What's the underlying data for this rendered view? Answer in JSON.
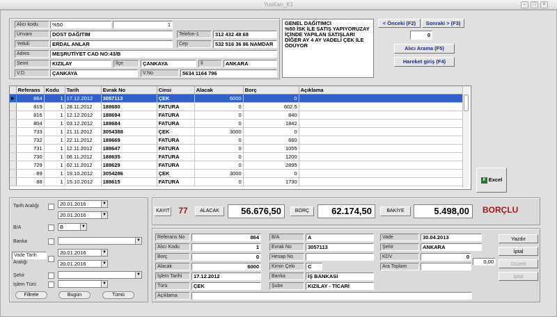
{
  "window": {
    "title": "YusKarı_K1"
  },
  "header": {
    "alici_kodu_label": "Alıcı kodu",
    "alici_kodu": "%50",
    "alici_no": "1",
    "unvan_label": "Ünvanı",
    "unvan": "DOST DAĞITIM",
    "tel_label": "Telefon-1",
    "tel": "312 432 48 68",
    "yetkili_label": "Yetkili",
    "yetkili": "ERDAL ANLAR",
    "cep_label": "Cep",
    "cep": "532 516 36 86 NAMDAR",
    "adres_label": "Adres",
    "adres": "MEŞRUTİYET CAD NO:43/B",
    "semt_label": "Semt",
    "semt": "KIZILAY",
    "ilce_label": "İlçe",
    "ilce": "ÇANKAYA",
    "il_label": "İl",
    "il": "ANKARA",
    "vd_label": "V.D.",
    "vd": "ÇANKAYA",
    "vno_label": "V.No",
    "vno": "5634 1164 796",
    "note": "GENEL DAĞITIMCI\n%50 İSK İLE SATIŞ YAPIYORUZAY İÇİNDE YAPILAN SATIŞLARI DİĞER AY 4 AY VADELİ ÇEK İLE ÖDÜYOR",
    "prev_btn": "< Önceki (F2)",
    "next_btn": "Sonraki > (F3)",
    "counter": "0",
    "search_btn": "Alıcı Arama (F5)",
    "move_btn": "Hareket giriş (F4)"
  },
  "grid": {
    "columns": [
      "Referans",
      "Kodu",
      "Tarih",
      "Evrak No",
      "Cinsi",
      "Alacak",
      "Borç",
      "Açıklama"
    ],
    "rows": [
      [
        "864",
        "1",
        "17.12.2012",
        "3057113",
        "ÇEK",
        "6000",
        "0",
        ""
      ],
      [
        "819",
        "1",
        "28.11.2012",
        "188680",
        "FATURA",
        "0",
        "602.5",
        ""
      ],
      [
        "816",
        "1",
        "12.12.2012",
        "188694",
        "FATURA",
        "0",
        "840",
        ""
      ],
      [
        "804",
        "1",
        "03.12.2012",
        "188684",
        "FATURA",
        "0",
        "1842",
        ""
      ],
      [
        "733",
        "1",
        "21.11.2012",
        "3054388",
        "ÇEK",
        "3000",
        "0",
        ""
      ],
      [
        "732",
        "1",
        "22.11.2012",
        "188669",
        "FATURA",
        "0",
        "660",
        ""
      ],
      [
        "731",
        "1",
        "12.11.2012",
        "188647",
        "FATURA",
        "0",
        "1055",
        ""
      ],
      [
        "730",
        "1",
        "06.11.2012",
        "188635",
        "FATURA",
        "0",
        "1200",
        ""
      ],
      [
        "729",
        "1",
        "02.11.2012",
        "188629",
        "FATURA",
        "0",
        "2895",
        ""
      ],
      [
        "89",
        "1",
        "19.10.2012",
        "3054286",
        "ÇEK",
        "3000",
        "0",
        ""
      ],
      [
        "88",
        "1",
        "15.10.2012",
        "188615",
        "FATURA",
        "0",
        "1730",
        ""
      ]
    ]
  },
  "excel_btn": "Excel",
  "filter": {
    "tarih_label": "Tarih Aralığı",
    "date1": "20.01.2016",
    "date2": "20.01.2016",
    "ba_label": "B/A",
    "ba": "B",
    "banka_label": "Banka",
    "vade_label": "Vade Tarih",
    "aralik_label": "Aralığı",
    "vdate1": "20.01.2016",
    "vdate2": "20.01.2016",
    "sehir_label": "Şehir",
    "islem_label": "İşlem Türü",
    "filtrele": "Filtrele",
    "bugun": "Bugün",
    "tumu": "Tümü"
  },
  "summary": {
    "kayit_label": "KAYIT",
    "kayit": "77",
    "alacak_label": "ALACAK",
    "alacak": "56.676,50",
    "borc_label": "BORÇ",
    "borc": "62.174,50",
    "bakiye_label": "BAKİYE",
    "bakiye": "5.498,00",
    "status": "BORÇLU",
    "status_color": "#a01818"
  },
  "detail": {
    "ref_label": "Referans No",
    "ref": "864",
    "ak_label": "Alıcı Kodu",
    "ak": "1",
    "borc_label": "Borç",
    "borc": "0",
    "alacak_label": "Alacak",
    "alacak": "6000",
    "it_label": "İşlem Tarihi",
    "it": "17.12.2012",
    "turu_label": "Türü",
    "turu": "ÇEK",
    "acik_label": "Açıklama",
    "acik": "",
    "ba_label": "B/A",
    "ba": "A",
    "evrak_label": "Evrak No",
    "evrak": "3057113",
    "hesap_label": "Hesap No",
    "hesap": "",
    "kimin_label": "Kimin Çeki",
    "kimin": "C",
    "banka_label": "Banka",
    "banka": "İŞ BANKASI",
    "sube_label": "Şube",
    "sube": "KIZILAY - TİCARİ",
    "vade_label": "Vade",
    "vade": "30.04.2013",
    "sehir_label": "Şehir",
    "sehir": "ANKARA",
    "kdv_label": "KDV",
    "kdv": "0",
    "ara_label": "Ara Toplam",
    "ara": "",
    "extra": "0,00",
    "yazdir": "Yazdır",
    "iptal1": "İptal",
    "duzelt": "Düzelt",
    "iptal2": "İptal"
  }
}
